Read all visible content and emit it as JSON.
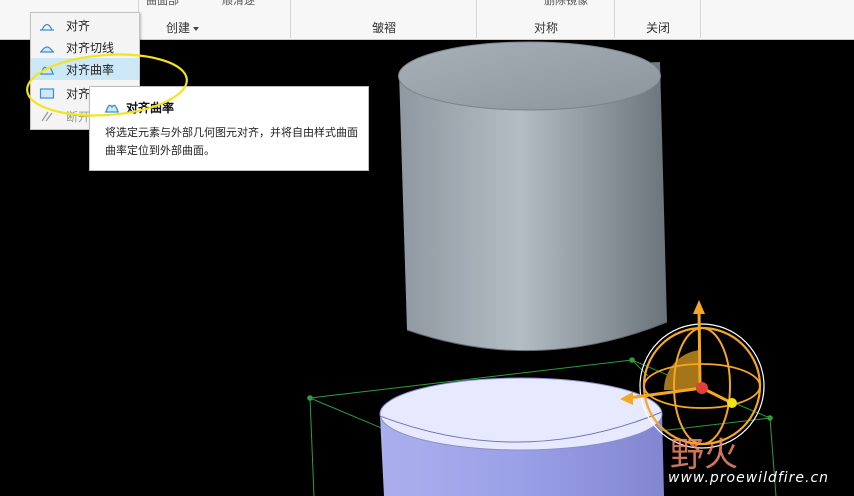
{
  "ribbon": {
    "groups": [
      {
        "label": "创建",
        "has_dropdown": true
      },
      {
        "label": "皱褶"
      },
      {
        "label": "对称"
      },
      {
        "label": "关闭"
      }
    ],
    "top_partial": [
      "曲面部",
      "顺滑逐",
      "删除镜像"
    ]
  },
  "menu": {
    "items": [
      {
        "label": "对齐",
        "icon": "align-icon",
        "state": "normal"
      },
      {
        "label": "对齐切线",
        "icon": "align-tangent-icon",
        "state": "normal"
      },
      {
        "label": "对齐曲率",
        "icon": "align-curvature-icon",
        "state": "highlighted"
      },
      {
        "label": "对齐",
        "icon": "align-normal-icon",
        "state": "normal"
      },
      {
        "label": "断开",
        "icon": "break-icon",
        "state": "disabled"
      }
    ]
  },
  "tooltip": {
    "title": "对齐曲率",
    "body": "将选定元素与外部几何图元对齐，并将自由样式曲面曲率定位到外部曲面。"
  },
  "watermark": {
    "logo_text": "野火",
    "url": "www.proewildfire.cn"
  },
  "colors": {
    "highlight_circle": "#f2e51a",
    "menu_highlight": "#cce8f7",
    "dragger": "#f5a623",
    "control_mesh": "#2e9d3a"
  }
}
